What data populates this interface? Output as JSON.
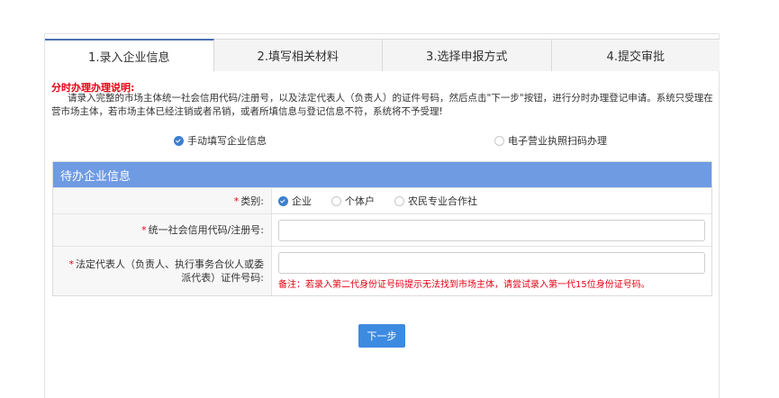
{
  "tabs": [
    {
      "label": "1.录入企业信息"
    },
    {
      "label": "2.填写相关材料"
    },
    {
      "label": "3.选择申报方式"
    },
    {
      "label": "4.提交审批"
    }
  ],
  "notice": {
    "title": "分时办理办理说明:",
    "text": "请录入完整的市场主体统一社会信用代码/注册号，以及法定代表人（负责人）的证件号码，然后点击\"下一步\"按钮，进行分时办理登记申请。系统只受理在营市场主体，若市场主体已经注销或者吊销，或者所填信息与登记信息不符，系统将不予受理!"
  },
  "mode": {
    "manual_label": "手动填写企业信息",
    "scan_label": "电子营业执照扫码办理"
  },
  "form": {
    "header": "待办企业信息",
    "type_label": "类别:",
    "type_options": [
      "企业",
      "个体户",
      "农民专业合作社"
    ],
    "credit_code_label": "统一社会信用代码/注册号:",
    "credit_code_value": "",
    "id_label": "法定代表人（负责人、执行事务合伙人或委派代表）证件号码:",
    "id_value": "",
    "id_hint": "备注：若录入第二代身份证号码提示无法找到市场主体，请尝试录入第一代15位身份证号码。",
    "required_mark": "*"
  },
  "next_button": "下一步",
  "colors": {
    "accent": "#3d8be0",
    "header_bg": "#6e9be2",
    "warning": "#e60012"
  }
}
